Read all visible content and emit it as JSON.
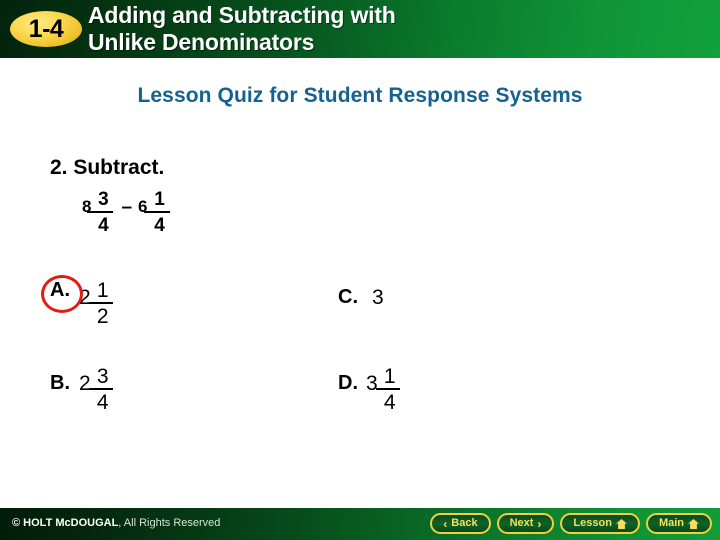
{
  "header": {
    "badge": "1-4",
    "title_line1": "Adding and Subtracting with",
    "title_line2": "Unlike Denominators"
  },
  "subtitle": "Lesson Quiz for Student Response Systems",
  "question": {
    "prompt": "2. Subtract.",
    "expression": {
      "left_whole": "8",
      "left_numerator": "3",
      "left_denominator": "4",
      "operator": "–",
      "right_whole": "6",
      "right_numerator": "1",
      "right_denominator": "4"
    }
  },
  "choices": [
    {
      "label": "A.",
      "whole": "2",
      "numerator": "1",
      "denominator": "2",
      "selected": true
    },
    {
      "label": "B.",
      "whole": "2",
      "numerator": "3",
      "denominator": "4",
      "selected": false
    },
    {
      "label": "C.",
      "whole": "3",
      "numerator": "",
      "denominator": "",
      "selected": false
    },
    {
      "label": "D.",
      "whole": "3",
      "numerator": "1",
      "denominator": "4",
      "selected": false
    }
  ],
  "footer": {
    "copyright_bold": "© HOLT McDOUGAL",
    "copyright_rest": ", All Rights Reserved",
    "buttons": [
      {
        "label": "Back",
        "icon": "chevron-left-icon",
        "glyph": "‹"
      },
      {
        "label": "Next",
        "icon": "chevron-right-icon",
        "glyph": "›"
      },
      {
        "label": "Lesson",
        "icon": "home-icon",
        "glyph": ""
      },
      {
        "label": "Main",
        "icon": "home-icon",
        "glyph": ""
      }
    ]
  },
  "colors": {
    "header_green_dark": "#03230d",
    "header_green_light": "#12a13c",
    "badge_gold": "#fbd94f",
    "subtitle_blue": "#14628f",
    "selection_red": "#e31c13",
    "button_gold": "#f2cf3e",
    "button_text": "#f6de62"
  }
}
